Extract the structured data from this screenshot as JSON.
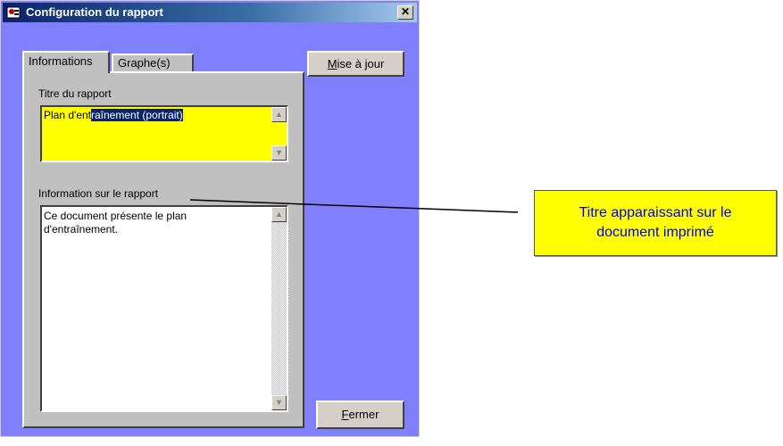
{
  "window": {
    "title": "Configuration du rapport",
    "close_glyph": "✕",
    "icon": "report-icon"
  },
  "tabs": [
    {
      "label": "Informations",
      "active": true
    },
    {
      "label": "Graphe(s)",
      "active": false
    }
  ],
  "fields": {
    "title_label": "Titre du rapport",
    "title_value_plain": "Plan d'ent",
    "title_value_selected": "raînement (portrait)",
    "info_label": "Information sur le rapport",
    "info_value_line1": "Ce document présente le plan",
    "info_value_line2": "d'entraînement."
  },
  "buttons": {
    "update_label_rest": "ise à jour",
    "update_mnemonic": "M",
    "close_label_rest": "ermer",
    "close_mnemonic": "F"
  },
  "callout": {
    "line1": "Titre apparaissant sur le",
    "line2": "document imprimé"
  },
  "colors": {
    "window_bg": "#8080ff",
    "title_field_bg": "#ffff00",
    "callout_text": "#0000ee"
  }
}
